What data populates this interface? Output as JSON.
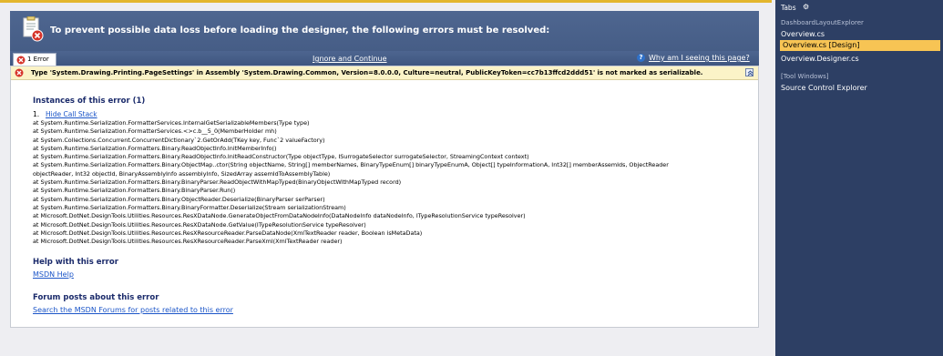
{
  "designer_error": {
    "header_text": "To prevent possible data loss before loading the designer, the following errors must be resolved:",
    "tab_label": "1 Error",
    "ignore_link": "Ignore and Continue",
    "why_link": "Why am I seeing this page?",
    "error_message": "Type 'System.Drawing.Printing.PageSettings' in Assembly 'System.Drawing.Common, Version=8.0.0.0, Culture=neutral, PublicKeyToken=cc7b13ffcd2ddd51' is not marked as serializable.",
    "instances_title": "Instances of this error (1)",
    "instance_number": "1.",
    "hide_call_stack": "Hide Call Stack",
    "call_stack": [
      "at System.Runtime.Serialization.FormatterServices.InternalGetSerializableMembers(Type type)",
      "at System.Runtime.Serialization.FormatterServices.<>c.b__5_0(MemberHolder mh)",
      "at System.Collections.Concurrent.ConcurrentDictionary`2.GetOrAdd(TKey key, Func`2 valueFactory)",
      "at System.Runtime.Serialization.Formatters.Binary.ReadObjectInfo.InitMemberInfo()",
      "at System.Runtime.Serialization.Formatters.Binary.ReadObjectInfo.InitReadConstructor(Type objectType, ISurrogateSelector surrogateSelector, StreamingContext context)",
      "at System.Runtime.Serialization.Formatters.Binary.ObjectMap..ctor(String objectName, String[] memberNames, BinaryTypeEnum[] binaryTypeEnumA, Object[] typeInformationA, Int32[] memberAssemIds, ObjectReader",
      "objectReader, Int32 objectId, BinaryAssemblyInfo assemblyInfo, SizedArray assemIdToAssemblyTable)",
      "at System.Runtime.Serialization.Formatters.Binary.BinaryParser.ReadObjectWithMapTyped(BinaryObjectWithMapTyped record)",
      "at System.Runtime.Serialization.Formatters.Binary.BinaryParser.Run()",
      "at System.Runtime.Serialization.Formatters.Binary.ObjectReader.Deserialize(BinaryParser serParser)",
      "at System.Runtime.Serialization.Formatters.Binary.BinaryFormatter.Deserialize(Stream serializationStream)",
      "at Microsoft.DotNet.DesignTools.Utilities.Resources.ResXDataNode.GenerateObjectFromDataNodeInfo(DataNodeInfo dataNodeInfo, ITypeResolutionService typeResolver)",
      "at Microsoft.DotNet.DesignTools.Utilities.Resources.ResXDataNode.GetValue(ITypeResolutionService typeResolver)",
      "at Microsoft.DotNet.DesignTools.Utilities.Resources.ResXResourceReader.ParseDataNode(XmlTextReader reader, Boolean isMetaData)",
      "at Microsoft.DotNet.DesignTools.Utilities.Resources.ResXResourceReader.ParseXml(XmlTextReader reader)"
    ],
    "help_title": "Help with this error",
    "msdn_help": "MSDN Help",
    "forum_title": "Forum posts about this error",
    "forum_link": "Search the MSDN Forums for posts related to this error"
  },
  "tabs_panel": {
    "title": "Tabs",
    "groups": [
      {
        "label": "DashboardLayoutExplorer",
        "items": [
          "Overview.cs",
          "Overview.cs [Design]",
          "Overview.Designer.cs"
        ]
      },
      {
        "label": "[Tool Windows]",
        "items": [
          "Source Control Explorer"
        ]
      }
    ],
    "selected_item": "Overview.cs [Design]"
  },
  "colors": {
    "header_blue": "#4e6690",
    "panel_navy": "#2d3f64",
    "selected_yellow": "#f7c454",
    "warning_bar": "#fbf3c7",
    "link_blue": "#1b55c8",
    "error_red": "#d6332a"
  }
}
